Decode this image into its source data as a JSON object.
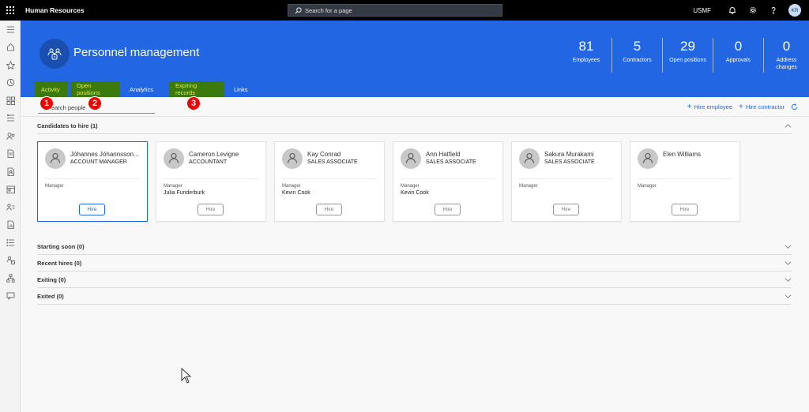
{
  "app": {
    "title": "Human Resources",
    "search_placeholder": "Search for a page",
    "company": "USMF",
    "user_initials": "KR"
  },
  "nav_icons": [
    "hamburger-icon",
    "home-icon",
    "star-icon",
    "recent-icon",
    "workspaces-icon",
    "modules-icon",
    "people-icon",
    "document-icon",
    "document-person-icon",
    "calendar-icon",
    "person-list-icon",
    "report-icon",
    "list-icon",
    "org-chart-icon",
    "hierarchy-icon",
    "message-icon"
  ],
  "workspace": {
    "title": "Personnel management",
    "kpis": [
      {
        "value": "81",
        "label": "Employees"
      },
      {
        "value": "5",
        "label": "Contractors"
      },
      {
        "value": "29",
        "label": "Open positions"
      },
      {
        "value": "0",
        "label": "Approvals"
      },
      {
        "value": "0",
        "label": "Address changes"
      }
    ],
    "tabs": [
      {
        "label": "Activity",
        "highlighted": true
      },
      {
        "label": "Open positions",
        "highlighted": true
      },
      {
        "label": "Analytics",
        "highlighted": false
      },
      {
        "label": "Expiring records",
        "highlighted": true
      },
      {
        "label": "Links",
        "highlighted": false
      }
    ]
  },
  "badges": [
    "1",
    "2",
    "3"
  ],
  "toolbar": {
    "search_placeholder": "Search people",
    "hire_employee": "Hire employee",
    "hire_contractor": "Hire contractor"
  },
  "sections": {
    "candidates": {
      "title": "Candidates to hire (1)",
      "cards": [
        {
          "name": "Jóhannes Jóhannsson...",
          "title": "ACCOUNT MANAGER",
          "manager_label": "Manager",
          "manager": "",
          "button": "Hire",
          "selected": true
        },
        {
          "name": "Cameron Levigne",
          "title": "ACCOUNTANT",
          "manager_label": "Manager",
          "manager": "Julia Funderburk",
          "button": "Hire",
          "selected": false
        },
        {
          "name": "Kay Conrad",
          "title": "SALES ASSOCIATE",
          "manager_label": "Manager",
          "manager": "Kevin Cook",
          "button": "Hire",
          "selected": false
        },
        {
          "name": "Ann Hatfield",
          "title": "SALES ASSOCIATE",
          "manager_label": "Manager",
          "manager": "Kevin Cook",
          "button": "Hire",
          "selected": false
        },
        {
          "name": "Sakura Murakami",
          "title": "SALES ASSOCIATE",
          "manager_label": "Manager",
          "manager": "",
          "button": "Hire",
          "selected": false
        },
        {
          "name": "Elen Williams",
          "title": "",
          "manager_label": "Manager",
          "manager": "",
          "button": "Hire",
          "selected": false
        }
      ]
    },
    "collapsed": [
      {
        "title": "Starting soon (0)"
      },
      {
        "title": "Recent hires (0)"
      },
      {
        "title": "Exiting (0)"
      },
      {
        "title": "Exited (0)"
      }
    ]
  },
  "colors": {
    "accent": "#2266e3",
    "highlight_bg": "#3b7a0c",
    "highlight_text": "#e5e84a",
    "badge": "#ee0000"
  }
}
